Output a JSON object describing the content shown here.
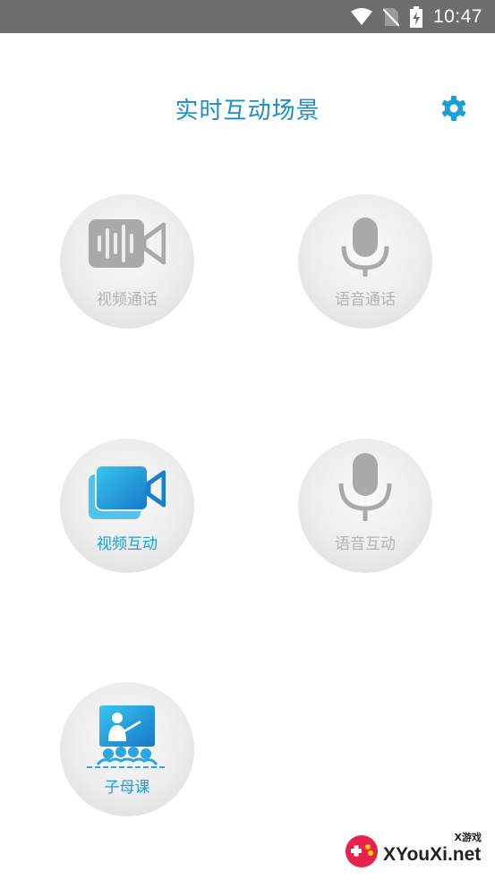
{
  "status_bar": {
    "time": "10:47"
  },
  "header": {
    "title": "实时互动场景"
  },
  "tiles": [
    {
      "label": "视频通话"
    },
    {
      "label": "语音通话"
    },
    {
      "label": "视频互动"
    },
    {
      "label": "语音互动"
    },
    {
      "label": "子母课"
    }
  ],
  "watermark": {
    "brand": "XYouXi.net",
    "tag": "X游戏"
  },
  "colors": {
    "accent": "#1a8fc4",
    "inactive": "#b3b3b3",
    "status_bar": "#6d6d6d"
  }
}
